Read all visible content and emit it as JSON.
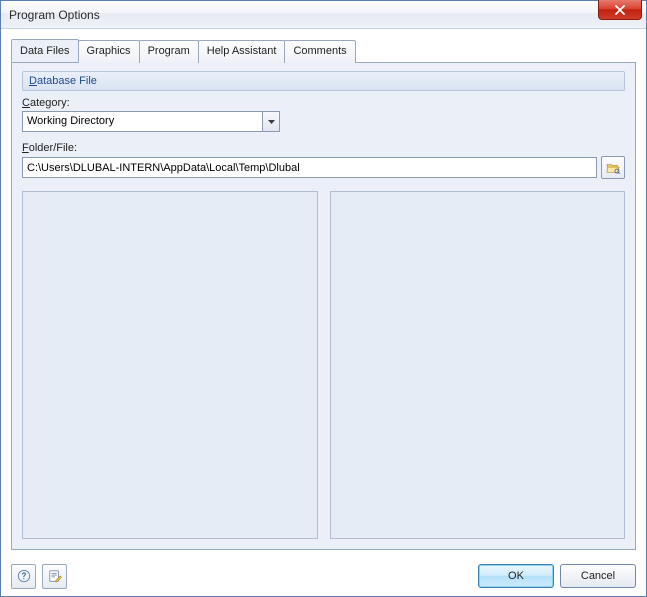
{
  "window": {
    "title": "Program Options"
  },
  "tabs": [
    {
      "label": "Data Files",
      "active": true
    },
    {
      "label": "Graphics",
      "active": false
    },
    {
      "label": "Program",
      "active": false
    },
    {
      "label": "Help Assistant",
      "active": false
    },
    {
      "label": "Comments",
      "active": false
    }
  ],
  "group": {
    "header_prefix": "D",
    "header_rest": "atabase File"
  },
  "category": {
    "label_prefix": "C",
    "label_rest": "ategory:",
    "value": "Working Directory"
  },
  "folder": {
    "label_prefix": "F",
    "label_rest": "older/File:",
    "value": "C:\\Users\\DLUBAL-INTERN\\AppData\\Local\\Temp\\Dlubal"
  },
  "buttons": {
    "ok": "OK",
    "cancel": "Cancel"
  }
}
